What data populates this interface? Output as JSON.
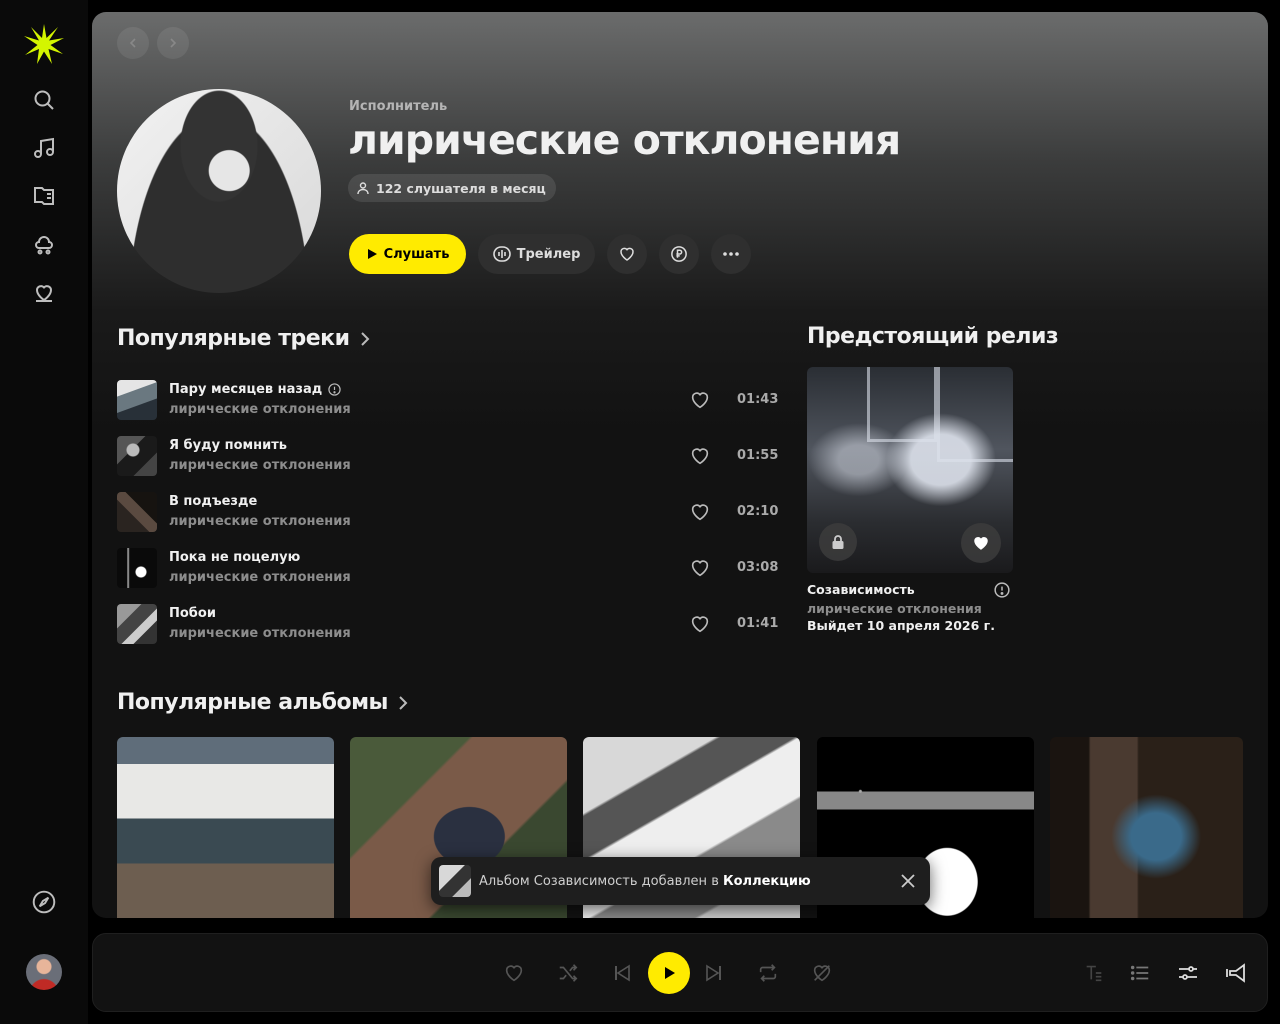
{
  "colors": {
    "accent": "#ffeb00",
    "bg": "#000000",
    "panel": "#121212",
    "muted": "#8d8d8d"
  },
  "sidebar": {
    "logo": "sun-logo-icon",
    "items": [
      {
        "icon": "search-icon"
      },
      {
        "icon": "music-note-icon"
      },
      {
        "icon": "book-icon"
      },
      {
        "icon": "kids-icon"
      },
      {
        "icon": "heart-collection-icon"
      }
    ],
    "bottom_icon": "compass-icon",
    "avatar": "user-avatar"
  },
  "artist": {
    "type": "Исполнитель",
    "name": "лирические отклонения",
    "listeners": "122 слушателя в месяц",
    "buttons": {
      "listen": "Слушать",
      "trailer": "Трейлер"
    }
  },
  "popular_tracks": {
    "title": "Популярные треки",
    "items": [
      {
        "title": "Пару месяцев назад",
        "artist": "лирические отклонения",
        "duration": "01:43",
        "explicit_info": true
      },
      {
        "title": "Я буду помнить",
        "artist": "лирические отклонения",
        "duration": "01:55"
      },
      {
        "title": "В подъезде",
        "artist": "лирические отклонения",
        "duration": "02:10"
      },
      {
        "title": "Пока не поцелую",
        "artist": "лирические отклонения",
        "duration": "03:08"
      },
      {
        "title": "Побои",
        "artist": "лирические отклонения",
        "duration": "01:41"
      }
    ]
  },
  "upcoming": {
    "title": "Предстоящий релиз",
    "release": {
      "title": "Созависимость",
      "artist": "лирические отклонения",
      "date": "Выйдет 10 апреля 2026 г."
    }
  },
  "popular_albums": {
    "title": "Популярные альбомы"
  },
  "toast": {
    "prefix": "Альбом Созависимость добавлен в",
    "link": "Коллекцию"
  }
}
